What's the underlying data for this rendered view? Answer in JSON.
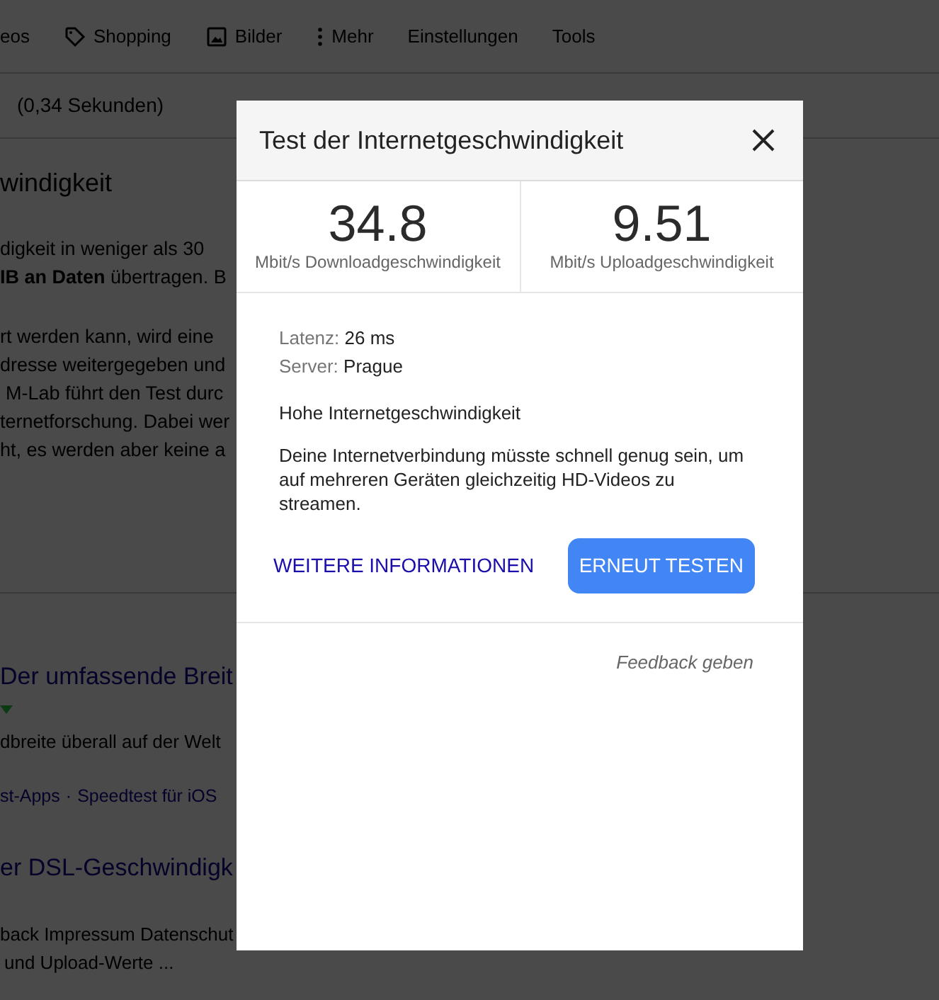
{
  "background": {
    "nav": [
      {
        "label": "eos"
      },
      {
        "label": "Shopping"
      },
      {
        "label": "Bilder"
      },
      {
        "label": "Mehr"
      },
      {
        "label": "Einstellungen"
      },
      {
        "label": "Tools"
      }
    ],
    "result_stats": "(0,34 Sekunden)",
    "heading": "windigkeit",
    "snippet_lines": [
      "digkeit in weniger als 30",
      "**IB an Daten** übertragen. B"
    ],
    "info_lines": [
      "rt werden kann, wird eine",
      "dresse weitergegeben und",
      "M-Lab führt den Test durc",
      "ternetforschung. Dabei wer",
      "ht, es werden aber keine a"
    ],
    "results": [
      {
        "title": "Der umfassende Breit",
        "has_menu": true,
        "snippet": "dbreite überall auf der Welt",
        "links": [
          "st-Apps",
          "Speedtest für iOS"
        ],
        "separator": "·"
      },
      {
        "title": "er DSL-Geschwindigk",
        "has_menu": false,
        "snippet_lines": [
          "back Impressum Datenschut",
          "und Upload-Werte ..."
        ]
      }
    ]
  },
  "dialog": {
    "title": "Test der Internetgeschwindigkeit",
    "stats": [
      {
        "value": "34.8",
        "label": "Mbit/s Downloadgeschwindigkeit"
      },
      {
        "value": "9.51",
        "label": "Mbit/s Uploadgeschwindigkeit"
      }
    ],
    "details": [
      {
        "label": "Latenz:",
        "value": "26 ms"
      },
      {
        "label": "Server:",
        "value": "Prague"
      }
    ],
    "verdict": "Hohe Internetgeschwindigkeit",
    "description": "Deine Internetverbindung müsste schnell genug sein, um auf mehreren Geräten gleichzeitig HD-Videos zu streamen.",
    "link": "WEITERE INFORMATIONEN",
    "button": "ERNEUT TESTEN",
    "feedback": "Feedback geben"
  }
}
